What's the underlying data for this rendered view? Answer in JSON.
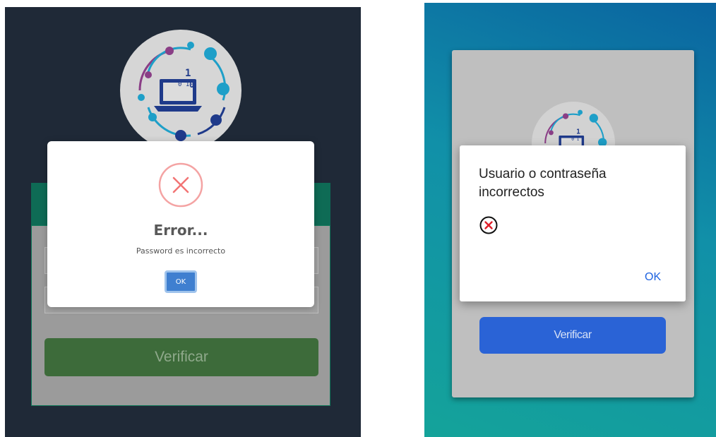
{
  "left_panel": {
    "card": {
      "verify_label": "Verificar"
    },
    "modal": {
      "title": "Error...",
      "message": "Password es incorrecto",
      "ok_label": "OK"
    },
    "colors": {
      "background": "#1f2937",
      "header": "#0e6b55",
      "verify_button": "#3d6b3a",
      "ok_button": "#3f7fd0",
      "error_icon": "#f27474"
    }
  },
  "right_panel": {
    "card": {
      "verify_label": "Verificar"
    },
    "dialog": {
      "title": "Usuario o contraseña incorrectos",
      "ok_label": "OK",
      "icon": "error-circle-icon"
    },
    "colors": {
      "verify_button": "#2a63d6",
      "ok_text": "#1f63e0"
    }
  }
}
